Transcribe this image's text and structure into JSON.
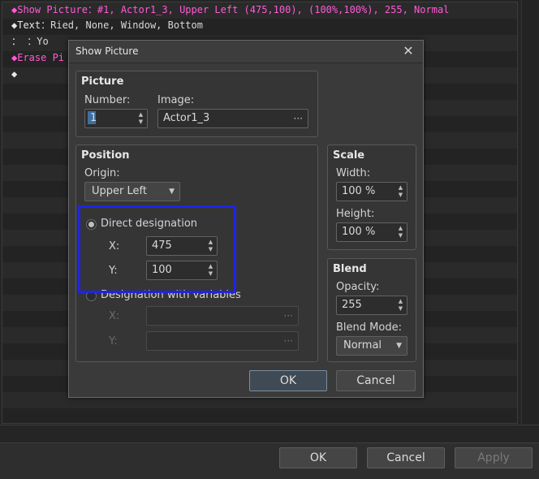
{
  "event_list": {
    "lines": [
      {
        "prefix": "◆Show Picture",
        "text": "：#1, Actor1_3, Upper Left (475,100), (100%,100%), 255, Normal"
      },
      {
        "prefix": "◆Text",
        "text": "：Ried, None, Window, Bottom"
      },
      {
        "prefix": "：",
        "text": "     ：Yo"
      },
      {
        "prefix": "◆Erase Pi",
        "text": ""
      },
      {
        "prefix": "◆",
        "text": ""
      }
    ]
  },
  "bottom_bar": {
    "ok": "OK",
    "cancel": "Cancel",
    "apply": "Apply"
  },
  "dialog": {
    "title": "Show Picture",
    "close_glyph": "✕",
    "picture": {
      "title": "Picture",
      "number_label": "Number:",
      "number_value": "1",
      "image_label": "Image:",
      "image_value": "Actor1_3",
      "browse_glyph": "···"
    },
    "position": {
      "title": "Position",
      "origin_label": "Origin:",
      "origin_value": "Upper Left",
      "direct_label": "Direct designation",
      "x_label": "X:",
      "x_value": "475",
      "y_label": "Y:",
      "y_value": "100",
      "variables_label": "Designation with variables",
      "var_x_label": "X:",
      "var_y_label": "Y:",
      "browse_glyph": "···"
    },
    "scale": {
      "title": "Scale",
      "width_label": "Width:",
      "width_value": "100 %",
      "height_label": "Height:",
      "height_value": "100 %"
    },
    "blend": {
      "title": "Blend",
      "opacity_label": "Opacity:",
      "opacity_value": "255",
      "mode_label": "Blend Mode:",
      "mode_value": "Normal"
    },
    "ok": "OK",
    "cancel": "Cancel"
  },
  "colors": {
    "command_magenta": "#ff5bd6",
    "highlight_blue": "#1f24e6"
  }
}
